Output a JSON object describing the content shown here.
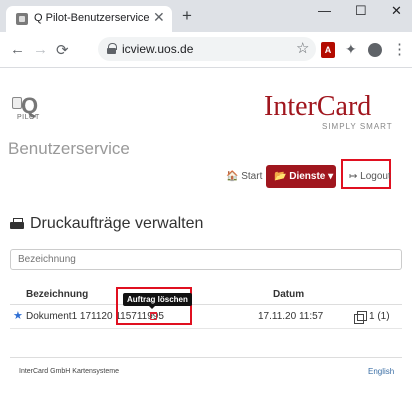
{
  "browser": {
    "tab_title": "Q Pilot-Benutzerservice",
    "tab_close": "✕",
    "new_tab": "+",
    "window_controls": [
      "—",
      "☐",
      "✕"
    ],
    "back": "←",
    "forward": "→",
    "reload": "⟳",
    "url": "icview.uos.de",
    "star": "☆",
    "pdf_ext": "A",
    "puzzle": "✦",
    "menu": "⋮"
  },
  "header": {
    "logo_letter": "Q",
    "logo_pilot": "PILOT",
    "brand_name": "InterCard",
    "brand_tagline": "SIMPLY SMART",
    "service_title": "Benutzerservice"
  },
  "nav": {
    "start": "🏠 Start",
    "dienste": "📂 Dienste ▾",
    "logout": "↦ Logout"
  },
  "main": {
    "title": "Druckaufträge verwalten",
    "search_placeholder": "Bezeichnung",
    "table": {
      "headers": [
        "Bezeichnung",
        "Datum"
      ],
      "rows": [
        {
          "star": "★",
          "name": "Dokument1 171120 115711995",
          "date": "17.11.20 11:57",
          "copies": "1 (1)"
        }
      ]
    },
    "tooltip": "Auftrag löschen"
  },
  "footer": {
    "company": "InterCard GmbH Kartensysteme",
    "language": "English"
  },
  "colors": {
    "brand": "#a0161e",
    "highlight": "#e01020",
    "link": "#3a6ea5"
  }
}
